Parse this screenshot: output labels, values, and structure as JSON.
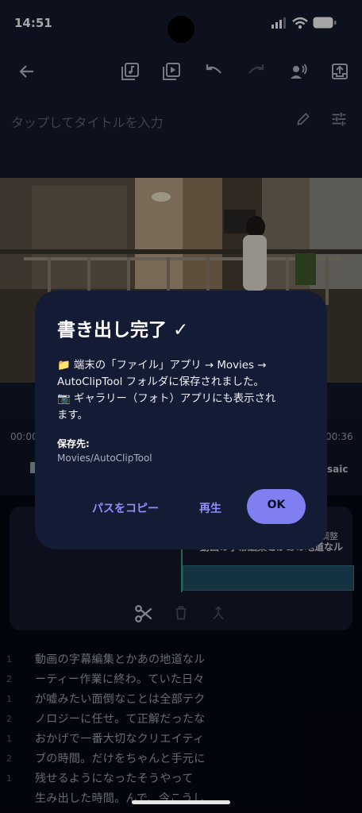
{
  "status_bar": {
    "time": "14:51"
  },
  "title_field": {
    "placeholder": "タップしてタイトルを入力"
  },
  "timeline": {
    "start_time": "00:00",
    "end_time": "00:36",
    "mosaic_label": "saic"
  },
  "editor": {
    "caption_text": "動画の字幕編集とかあの地道なル",
    "adjust_label": "調整"
  },
  "lyrics": [
    {
      "num": "1",
      "text": "動画の字幕編集とかあの地道なル"
    },
    {
      "num": "2",
      "text": "ーティー作業に終わ。ていた日々"
    },
    {
      "num": "1",
      "text": "が嘘みたい面倒なことは全部テク"
    },
    {
      "num": "2",
      "text": "ノロジーに任せ。て正解だったな"
    },
    {
      "num": "1",
      "text": "おかげで一番大切なクリエイティ"
    },
    {
      "num": "2",
      "text": "ブの時間。だけをちゃんと手元に"
    },
    {
      "num": "1",
      "text": "残せるようになったそうやって"
    },
    {
      "num": "",
      "text": "生み出した時間。んで、今こうし"
    }
  ],
  "dialog": {
    "title": "書き出し完了 ✓",
    "body_line1": "📁 端末の「ファイル」アプリ → Movies →",
    "body_line2": "AutoClipTool フォルダに保存されました。",
    "body_line3": "📷 ギャラリー（フォト）アプリにも表示され",
    "body_line4": "ます。",
    "save_label": "保存先:",
    "save_path": "Movies/AutoClipTool",
    "copy_path_label": "パスをコピー",
    "play_label": "再生",
    "ok_label": "OK"
  },
  "colors": {
    "accent": "#7f7ff2",
    "dialog_bg": "#141b34",
    "app_bg": "#151b2d",
    "timeline_clip": "#1f4d63"
  }
}
